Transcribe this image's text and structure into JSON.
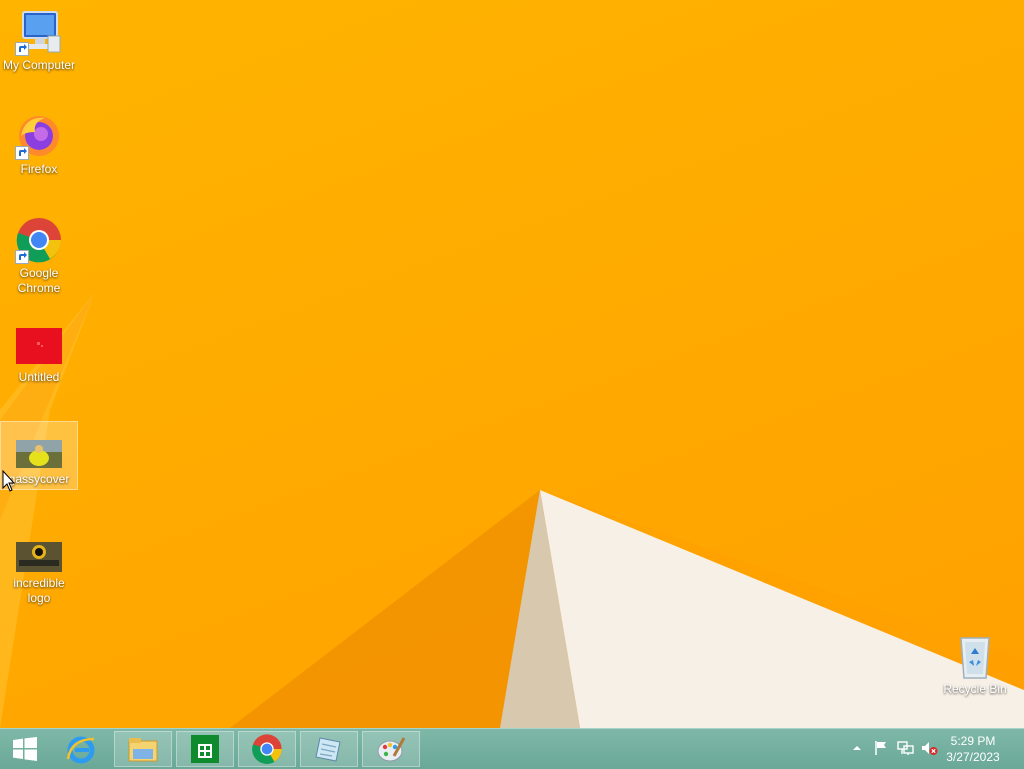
{
  "desktop": {
    "icons": [
      {
        "label": "My Computer"
      },
      {
        "label": "Firefox"
      },
      {
        "label": "Google Chrome"
      },
      {
        "label": "Untitled"
      },
      {
        "label": "gassycover"
      },
      {
        "label": "incredible logo"
      },
      {
        "label": "Recycle Bin"
      }
    ]
  },
  "taskbar": {
    "start_icon": "windows-logo-icon",
    "pinned": [
      "internet-explorer-icon",
      "file-explorer-icon",
      "store-icon",
      "chrome-icon",
      "notepad-icon",
      "paint-icon"
    ],
    "tray": [
      "show-hidden-icons-icon",
      "action-center-flag-icon",
      "network-icon",
      "volume-muted-icon"
    ],
    "clock": {
      "time": "5:29 PM",
      "date": "3/27/2023"
    }
  },
  "colors": {
    "wallpaper": "#ffb400",
    "taskbar": "#76b2a1"
  }
}
